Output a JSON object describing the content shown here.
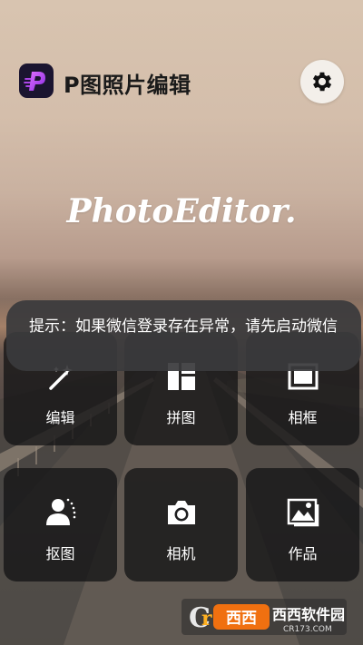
{
  "header": {
    "title": "P图照片编辑",
    "logo_icon": "app-logo-icon",
    "settings_icon": "gear-icon"
  },
  "brand": {
    "text": "PhotoEditor."
  },
  "tools": [
    {
      "label": "编辑",
      "icon": "magic-wand-icon"
    },
    {
      "label": "拼图",
      "icon": "collage-grid-icon"
    },
    {
      "label": "相框",
      "icon": "frame-icon"
    },
    {
      "label": "抠图",
      "icon": "cutout-person-icon"
    },
    {
      "label": "相机",
      "icon": "camera-icon"
    },
    {
      "label": "作品",
      "icon": "gallery-icon"
    }
  ],
  "toast": {
    "message": "提示：如果微信登录存在异常，请先启动微信"
  },
  "watermark": {
    "brand": "西西软件园",
    "url": "CR173.COM"
  },
  "colors": {
    "logo_bg": "#1b1530",
    "logo_accent": "#c04cff",
    "tile_bg": "#141416",
    "toast_bg": "#3a3a3c"
  }
}
